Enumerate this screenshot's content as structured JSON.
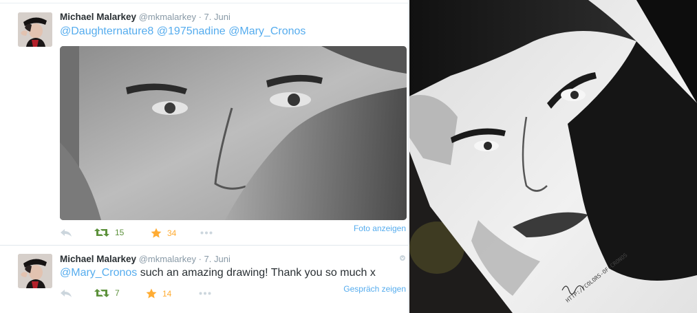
{
  "tweets": [
    {
      "name": "Michael Malarkey",
      "handle": "@mkmalarkey",
      "separator": "·",
      "date": "7. Juni",
      "text_mentions": [
        "@Daughternature8",
        "@1975nadine",
        "@Mary_Cronos"
      ],
      "retweets": "15",
      "favorites": "34",
      "side_link": "Foto anzeigen"
    },
    {
      "name": "Michael Malarkey",
      "handle": "@mkmalarkey",
      "separator": "·",
      "date": "7. Juni",
      "text_mention": "@Mary_Cronos",
      "text_body": " such an amazing drawing! Thank you so much x",
      "retweets": "7",
      "favorites": "14",
      "side_link": "Gespräch zeigen"
    }
  ],
  "drawing": {
    "signature": "Mary Cronos",
    "url_text": "HTTP://COLORS-OF-CRONOS"
  },
  "colors": {
    "link": "#55acee",
    "retweet": "#5c913b",
    "favorite": "#ffac33",
    "text": "#292f33",
    "muted": "#8899a6"
  },
  "icons": [
    "reply-icon",
    "retweet-icon",
    "favorite-icon",
    "more-icon",
    "caret-down-icon"
  ]
}
